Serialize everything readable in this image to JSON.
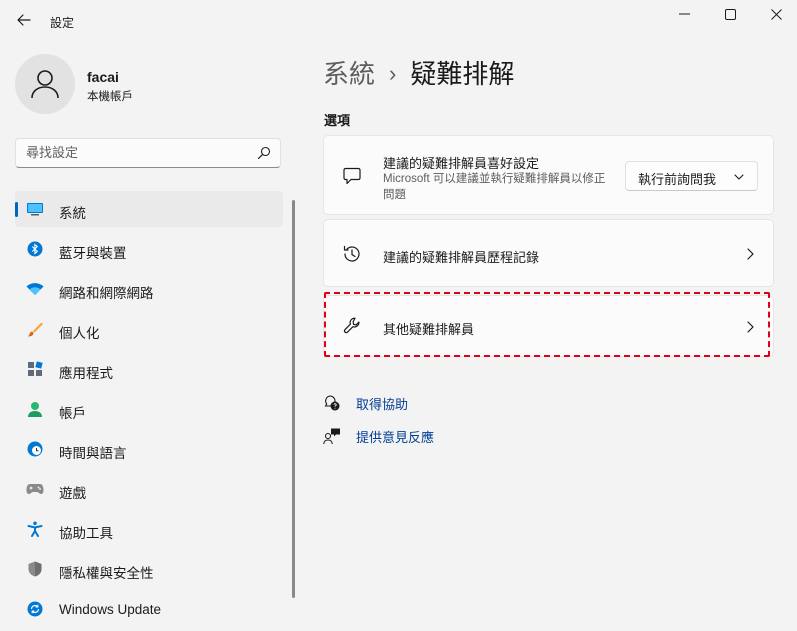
{
  "window": {
    "title": "設定",
    "back_icon": "arrow-left-icon",
    "minimize_icon": "minimize-icon",
    "maximize_icon": "maximize-icon",
    "close_icon": "close-icon"
  },
  "user": {
    "name": "facai",
    "account_type": "本機帳戶",
    "avatar_icon": "person-icon"
  },
  "search": {
    "placeholder": "尋找設定",
    "value": "",
    "icon": "search-icon"
  },
  "sidebar": {
    "items": [
      {
        "label": "系統",
        "icon": "monitor-icon",
        "selected": true
      },
      {
        "label": "藍牙與裝置",
        "icon": "bluetooth-icon",
        "selected": false
      },
      {
        "label": "網路和網際網路",
        "icon": "wifi-icon",
        "selected": false
      },
      {
        "label": "個人化",
        "icon": "brush-icon",
        "selected": false
      },
      {
        "label": "應用程式",
        "icon": "apps-icon",
        "selected": false
      },
      {
        "label": "帳戶",
        "icon": "account-icon",
        "selected": false
      },
      {
        "label": "時間與語言",
        "icon": "globe-clock-icon",
        "selected": false
      },
      {
        "label": "遊戲",
        "icon": "gamepad-icon",
        "selected": false
      },
      {
        "label": "協助工具",
        "icon": "accessibility-icon",
        "selected": false
      },
      {
        "label": "隱私權與安全性",
        "icon": "shield-icon",
        "selected": false
      },
      {
        "label": "Windows Update",
        "icon": "windows-update-icon",
        "selected": false
      }
    ]
  },
  "main": {
    "breadcrumb": {
      "parent": "系統",
      "separator": "›",
      "current": "疑難排解"
    },
    "section_label": "選項",
    "cards": [
      {
        "title": "建議的疑難排解員喜好設定",
        "description": "Microsoft 可以建議並執行疑難排解員以修正問題",
        "icon": "chat-bubble-icon",
        "dropdown_value": "執行前詢問我"
      },
      {
        "title": "建議的疑難排解員歷程記錄",
        "icon": "history-icon"
      },
      {
        "title": "其他疑難排解員",
        "icon": "wrench-icon",
        "highlighted": true
      }
    ],
    "links": [
      {
        "label": "取得協助",
        "icon": "help-chat-icon"
      },
      {
        "label": "提供意見反應",
        "icon": "feedback-icon"
      }
    ]
  },
  "colors": {
    "accent": "#0067c0",
    "link": "#003e92",
    "highlight": "#e0001c",
    "background": "#f3f3f3",
    "card": "#fbfbfb"
  }
}
